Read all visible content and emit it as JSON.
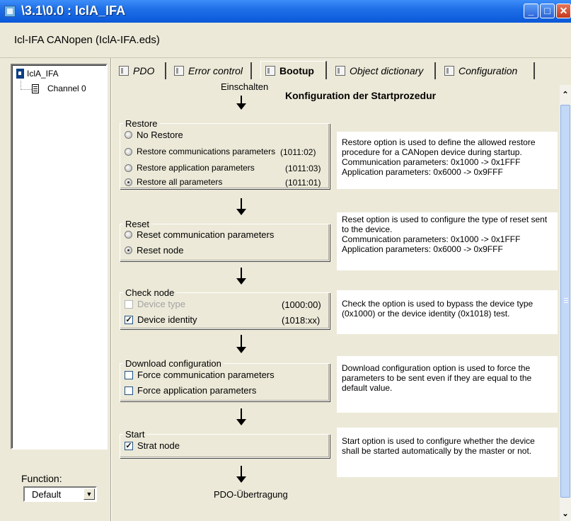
{
  "window": {
    "title": "\\3.1\\0.0 : IclA_IFA"
  },
  "header": {
    "device_label": "Icl-IFA CANopen (IclA-IFA.eds)"
  },
  "tree": {
    "root": "IclA_IFA",
    "child": "Channel 0"
  },
  "function": {
    "label": "Function:",
    "value": "Default"
  },
  "tabs": [
    {
      "label": "PDO"
    },
    {
      "label": "Error control"
    },
    {
      "label": "Bootup"
    },
    {
      "label": "Object dictionary"
    },
    {
      "label": "Configuration"
    }
  ],
  "bootup": {
    "start_label": "Einschalten",
    "heading": "Konfiguration der Startprozedur",
    "end_label": "PDO-Übertragung",
    "restore": {
      "title": "Restore",
      "options": [
        {
          "label": "No Restore",
          "code": "",
          "selected": false
        },
        {
          "label": "Restore communications parameters",
          "code": "(1011:02)",
          "selected": false
        },
        {
          "label": "Restore application parameters",
          "code": "(1011:03)",
          "selected": false
        },
        {
          "label": "Restore all parameters",
          "code": "(1011:01)",
          "selected": true
        }
      ],
      "description": "Restore option is used to define the allowed restore procedure for a CANopen device during startup.\nCommunication parameters: 0x1000 -> 0x1FFF\nApplication parameters: 0x6000 -> 0x9FFF"
    },
    "reset": {
      "title": "Reset",
      "options": [
        {
          "label": "Reset communication parameters",
          "selected": false
        },
        {
          "label": "Reset node",
          "selected": true
        }
      ],
      "description": "Reset option is used to configure the type of reset sent to the device.\nCommunication parameters: 0x1000 -> 0x1FFF\nApplication parameters: 0x6000 -> 0x9FFF"
    },
    "check_node": {
      "title": "Check node",
      "options": [
        {
          "label": "Device type",
          "code": "(1000:00)",
          "checked": false,
          "enabled": false
        },
        {
          "label": "Device identity",
          "code": "(1018:xx)",
          "checked": true,
          "enabled": true
        }
      ],
      "description": "Check the option is used to bypass the device type (0x1000) or the device identity (0x1018) test."
    },
    "download": {
      "title": "Download configuration",
      "options": [
        {
          "label": "Force communication parameters",
          "checked": false
        },
        {
          "label": "Force application parameters",
          "checked": false
        }
      ],
      "description": "Download configuration option is used to force the parameters to be sent even if they are equal to the default value."
    },
    "start": {
      "title": "Start",
      "options": [
        {
          "label": "Strat node",
          "checked": true
        }
      ],
      "description": "Start option is used to configure whether the device shall be started automatically by the master or not."
    }
  },
  "icons": {
    "window": "app-icon",
    "minimize": "minimize-icon",
    "maximize": "maximize-icon",
    "close": "close-icon",
    "tab": "tab-page-icon",
    "tree_root": "device-icon",
    "tree_child": "document-icon"
  },
  "colors": {
    "titlebar": "#0a58d8",
    "background": "#ece9d8",
    "close_button": "#c3391c"
  }
}
